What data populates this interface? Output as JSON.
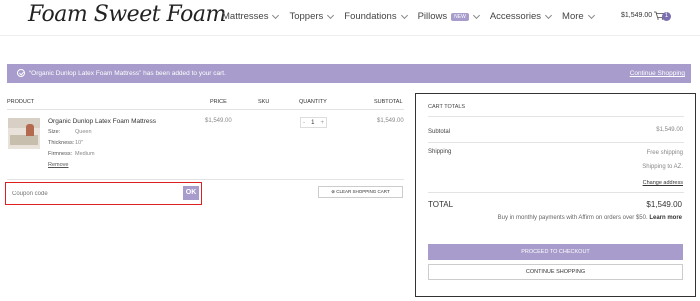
{
  "header": {
    "logo": "Foam Sweet Foam",
    "nav": [
      {
        "label": "Mattresses"
      },
      {
        "label": "Toppers"
      },
      {
        "label": "Foundations"
      },
      {
        "label": "Pillows",
        "badge": "NEW"
      },
      {
        "label": "Accessories"
      },
      {
        "label": "More"
      }
    ],
    "cart_total": "$1,549.00",
    "cart_count": "1"
  },
  "notice": {
    "text": "“Organic Dunlop Latex Foam Mattress” has been added to your cart.",
    "link": "Continue Shopping"
  },
  "cart_table": {
    "headers": {
      "product": "PRODUCT",
      "price": "PRICE",
      "sku": "SKU",
      "quantity": "QUANTITY",
      "subtotal": "SUBTOTAL"
    },
    "item": {
      "name": "Organic Dunlop Latex Foam Mattress",
      "attributes": [
        {
          "label": "Size:",
          "value": "Queen"
        },
        {
          "label": "Thickness:",
          "value": "10\""
        },
        {
          "label": "Firmness:",
          "value": "Medium"
        }
      ],
      "remove": "Remove",
      "price": "$1,549.00",
      "quantity": "1",
      "qty_minus": "-",
      "qty_plus": "+",
      "subtotal": "$1,549.00"
    }
  },
  "coupon": {
    "placeholder": "Coupon code",
    "button": "OK"
  },
  "clear_cart": "⊗ CLEAR SHOPPING CART",
  "totals": {
    "title": "CART TOTALS",
    "subtotal_label": "Subtotal",
    "subtotal_value": "$1,549.00",
    "shipping_label": "Shipping",
    "shipping_value": "Free shipping",
    "shipping_dest": "Shipping to AZ.",
    "change_address": "Change address",
    "total_label": "TOTAL",
    "total_value": "$1,549.00",
    "affirm_text": "Buy in monthly payments with Affirm on orders over $50.",
    "affirm_link": "Learn more",
    "checkout": "PROCEED TO CHECKOUT",
    "continue": "CONTINUE SHOPPING"
  },
  "colors": {
    "accent": "#a79ccb",
    "highlight": "#e02020"
  }
}
